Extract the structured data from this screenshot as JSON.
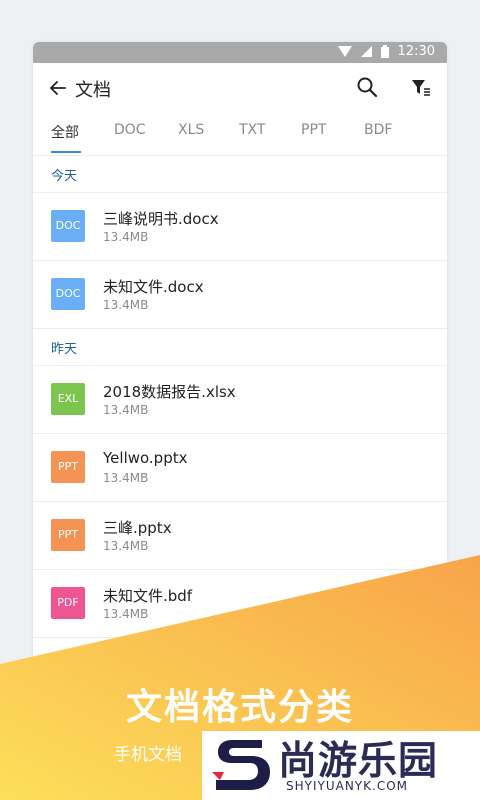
{
  "status": {
    "time": "12:30"
  },
  "header": {
    "title": "文档"
  },
  "tabs": [
    "全部",
    "DOC",
    "XLS",
    "TXT",
    "PPT",
    "BDF"
  ],
  "sections": [
    {
      "label": "今天",
      "items": [
        {
          "badge": "DOC",
          "color": "#6aaef5",
          "name": "三峰说明书.docx",
          "size": "13.4MB"
        },
        {
          "badge": "DOC",
          "color": "#6aaef5",
          "name": "未知文件.docx",
          "size": "13.4MB"
        }
      ]
    },
    {
      "label": "昨天",
      "items": [
        {
          "badge": "EXL",
          "color": "#7cc54f",
          "name": "2018数据报告.xlsx",
          "size": "13.4MB"
        },
        {
          "badge": "PPT",
          "color": "#f49353",
          "name": "Yellwo.pptx",
          "size": "13.4MB"
        },
        {
          "badge": "PPT",
          "color": "#f49353",
          "name": "三峰.pptx",
          "size": "13.4MB"
        },
        {
          "badge": "PDF",
          "color": "#ee5592",
          "name": "未知文件.bdf",
          "size": "13.4MB"
        }
      ]
    }
  ],
  "banner": {
    "headline": "文档格式分类",
    "subline": "手机文档",
    "watermark_cn": "尚游乐园",
    "watermark_en": "SHYIYUANYK.COM"
  }
}
